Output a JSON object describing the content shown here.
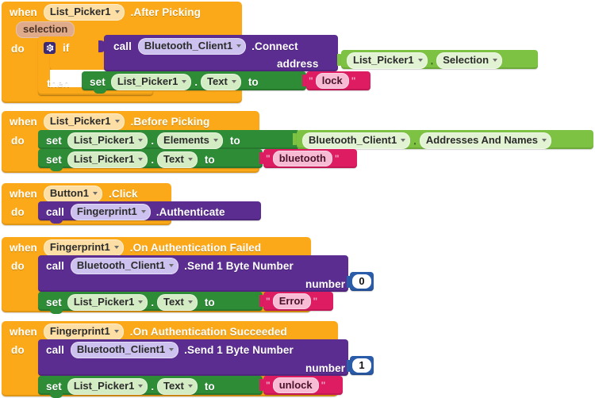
{
  "editor": {
    "name": "MIT App Inventor Blocks Editor",
    "background": "#ffffff"
  },
  "palette": {
    "event_orange": "#fba919",
    "call_purple": "#5c2d91",
    "set_green": "#2e8b36",
    "getter_green": "#7dc242",
    "text_magenta": "#de1c61",
    "number_blue": "#2a5caa",
    "param_tan": "#dfab8b"
  },
  "keywords": {
    "when": "when",
    "do": "do",
    "if": "if",
    "then": "then",
    "call": "call",
    "set": "set",
    "to": "to",
    "dot": "."
  },
  "blocks": [
    {
      "id": "listpicker-after-picking",
      "event": {
        "component": "List_Picker1",
        "event_name": ".After Picking",
        "parameter": "selection"
      },
      "statements": [
        {
          "kind": "if",
          "condition": {
            "kind": "call",
            "component": "Bluetooth_Client1",
            "method": ".Connect",
            "args": [
              {
                "label": "address",
                "value": {
                  "kind": "getter",
                  "component": "List_Picker1",
                  "property": "Selection"
                }
              }
            ]
          },
          "then": [
            {
              "kind": "set",
              "component": "List_Picker1",
              "property": "Text",
              "value": {
                "kind": "text",
                "string": "lock"
              }
            }
          ]
        }
      ]
    },
    {
      "id": "listpicker-before-picking",
      "event": {
        "component": "List_Picker1",
        "event_name": ".Before Picking",
        "parameter": null
      },
      "statements": [
        {
          "kind": "set",
          "component": "List_Picker1",
          "property": "Elements",
          "value": {
            "kind": "getter",
            "component": "Bluetooth_Client1",
            "property": "Addresses And Names"
          }
        },
        {
          "kind": "set",
          "component": "List_Picker1",
          "property": "Text",
          "value": {
            "kind": "text",
            "string": "bluetooth"
          }
        }
      ]
    },
    {
      "id": "button1-click",
      "event": {
        "component": "Button1",
        "event_name": ".Click",
        "parameter": null
      },
      "statements": [
        {
          "kind": "call",
          "component": "Fingerprint1",
          "method": ".Authenticate",
          "args": []
        }
      ]
    },
    {
      "id": "fingerprint-auth-failed",
      "event": {
        "component": "Fingerprint1",
        "event_name": ".On Authentication Failed",
        "parameter": null
      },
      "statements": [
        {
          "kind": "call",
          "component": "Bluetooth_Client1",
          "method": ".Send 1 Byte Number",
          "args": [
            {
              "label": "number",
              "value": {
                "kind": "number",
                "number": "0"
              }
            }
          ]
        },
        {
          "kind": "set",
          "component": "List_Picker1",
          "property": "Text",
          "value": {
            "kind": "text",
            "string": "Error"
          }
        }
      ]
    },
    {
      "id": "fingerprint-auth-succeeded",
      "event": {
        "component": "Fingerprint1",
        "event_name": ".On Authentication Succeeded",
        "parameter": null
      },
      "statements": [
        {
          "kind": "call",
          "component": "Bluetooth_Client1",
          "method": ".Send 1 Byte Number",
          "args": [
            {
              "label": "number",
              "value": {
                "kind": "number",
                "number": "1"
              }
            }
          ]
        },
        {
          "kind": "set",
          "component": "List_Picker1",
          "property": "Text",
          "value": {
            "kind": "text",
            "string": "unlock"
          }
        }
      ]
    }
  ]
}
